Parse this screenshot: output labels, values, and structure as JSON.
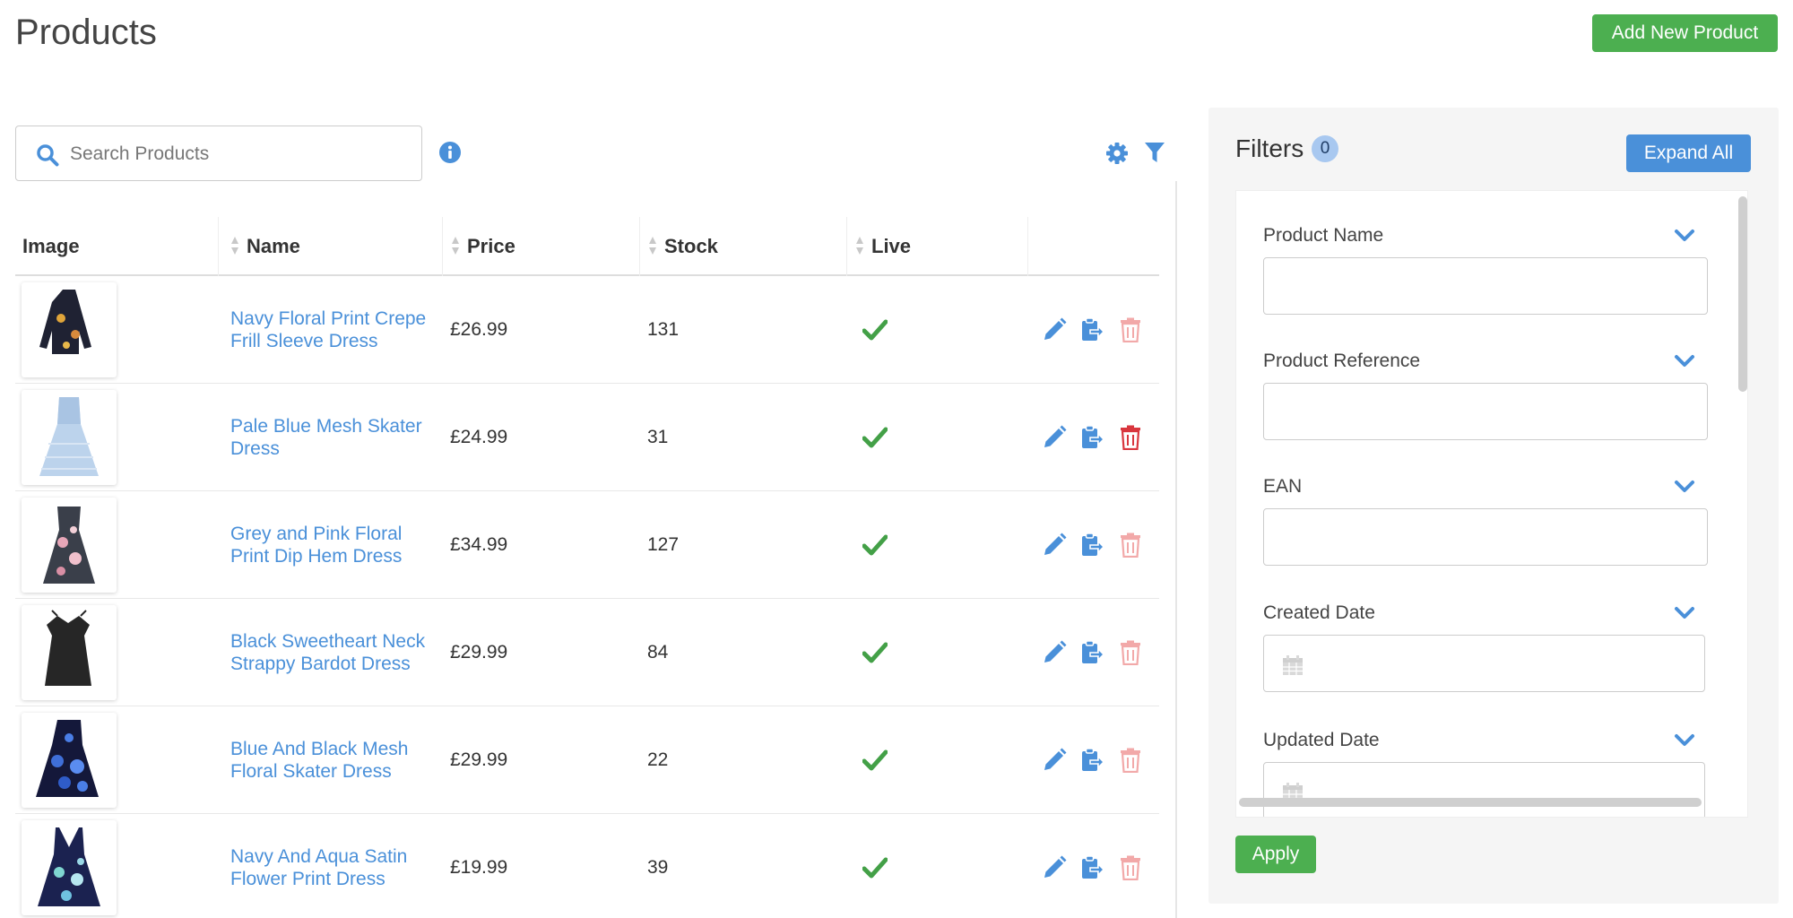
{
  "page": {
    "title": "Products"
  },
  "toolbar": {
    "add_label": "Add New Product"
  },
  "search": {
    "placeholder": "Search Products",
    "value": ""
  },
  "table": {
    "headers": {
      "image": "Image",
      "name": "Name",
      "price": "Price",
      "stock": "Stock",
      "live": "Live"
    },
    "rows": [
      {
        "name": "Navy Floral Print Crepe Frill Sleeve Dress",
        "price": "£26.99",
        "stock": "131",
        "live": true,
        "delete_enabled": false
      },
      {
        "name": "Pale Blue Mesh Skater Dress",
        "price": "£24.99",
        "stock": "31",
        "live": true,
        "delete_enabled": true
      },
      {
        "name": "Grey and Pink Floral Print Dip Hem Dress",
        "price": "£34.99",
        "stock": "127",
        "live": true,
        "delete_enabled": false
      },
      {
        "name": "Black Sweetheart Neck Strappy Bardot Dress",
        "price": "£29.99",
        "stock": "84",
        "live": true,
        "delete_enabled": false
      },
      {
        "name": "Blue And Black Mesh Floral Skater Dress",
        "price": "£29.99",
        "stock": "22",
        "live": true,
        "delete_enabled": false
      },
      {
        "name": "Navy And Aqua Satin Flower Print Dress",
        "price": "£19.99",
        "stock": "39",
        "live": true,
        "delete_enabled": false
      }
    ]
  },
  "filters": {
    "title": "Filters",
    "count": "0",
    "expand_label": "Expand All",
    "apply_label": "Apply",
    "groups": [
      {
        "label": "Product Name"
      },
      {
        "label": "Product Reference"
      },
      {
        "label": "EAN"
      },
      {
        "label": "Created Date"
      },
      {
        "label": "Updated Date"
      }
    ]
  },
  "colors": {
    "accent_blue": "#4a90d9",
    "success_green": "#4caf50",
    "check_green": "#43a047",
    "delete_red": "#d9363e",
    "delete_red_faded": "#f2a9a9"
  },
  "icons": {
    "search": "search-icon",
    "info": "info-icon",
    "settings": "gear-icon",
    "filter": "funnel-icon",
    "live": "checkmark-icon",
    "edit": "pencil-icon",
    "copy": "clipboard-copy-icon",
    "delete": "trash-icon",
    "expand": "chevron-down-icon",
    "date": "calendar-icon"
  }
}
